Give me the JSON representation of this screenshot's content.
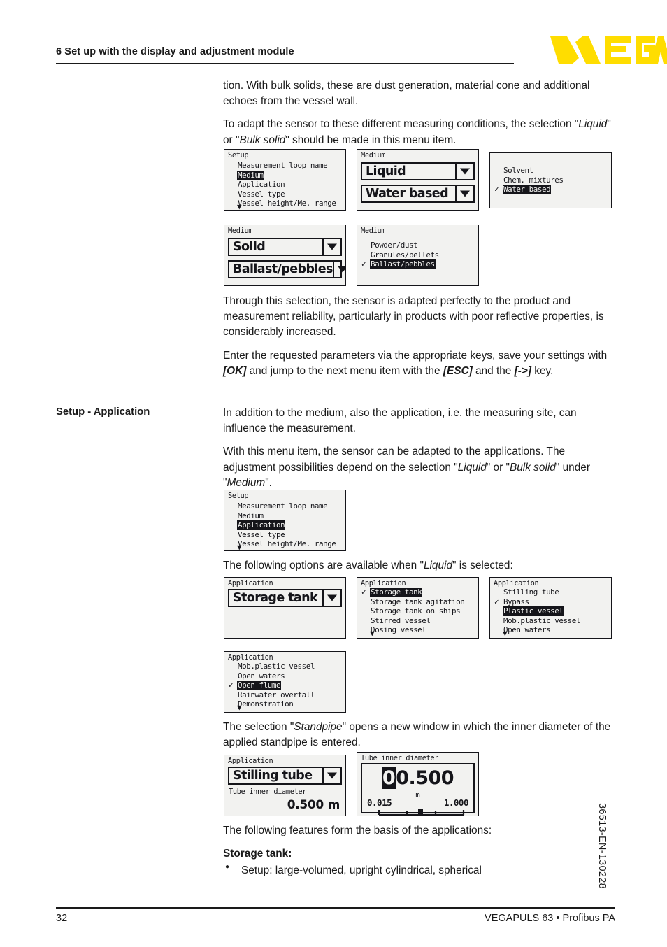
{
  "header": {
    "chapter_title": "6 Set up with the display and adjustment module",
    "logo_text": "VEGA",
    "logo_color": "#FFDD00"
  },
  "footer": {
    "page_number": "32",
    "product_line": "VEGAPULS 63 • Profibus PA",
    "doc_code": "36513-EN-130228"
  },
  "body": {
    "p1_a": "tion. With bulk solids, these are dust generation, material cone and additional echoes from the vessel wall.",
    "p2_pre": "To adapt the sensor to these different measuring conditions, the selection \"",
    "p2_i1": "Liquid",
    "p2_mid": "\" or \"",
    "p2_i2": "Bulk solid",
    "p2_post": "\" should be made in this menu item.",
    "p3": "Through this selection, the sensor is adapted perfectly to the product and measurement reliability, particularly in products with poor reflective properties, is considerably increased.",
    "p4_pre": "Enter the requested parameters via the appropriate keys, save your settings with ",
    "p4_k1": "[OK]",
    "p4_mid": " and jump to the next menu item with the ",
    "p4_k2": "[ESC]",
    "p4_mid2": " and the ",
    "p4_k3": "[->]",
    "p4_post": " key.",
    "marginal_heading": "Setup - Application",
    "p5": "In addition to the medium, also the application, i.e. the measuring site, can influence the measurement.",
    "p6_pre": "With this menu item, the sensor can be adapted to the applications. The adjustment possibilities depend on the selection \"",
    "p6_i1": "Liquid",
    "p6_mid": "\" or \"",
    "p6_i2": "Bulk solid",
    "p6_mid2": "\" under \"",
    "p6_i3": "Medium",
    "p6_post": "\".",
    "p7_pre": "The following options are available when \"",
    "p7_i1": "Liquid",
    "p7_post": "\" is selected:",
    "p8_pre": "The selection \"",
    "p8_i1": "Standpipe",
    "p8_post": "\" opens a new window in which the inner diameter of the applied standpipe is entered.",
    "p9": "The following features form the basis of the applications:",
    "storage_tank_heading": "Storage tank:",
    "storage_tank_bullet_1": "Setup: large-volumed, upright cylindrical, spherical"
  },
  "screens": {
    "setup_medium": {
      "title": "Setup",
      "rows": [
        {
          "label": "Measurement loop name",
          "selected": false,
          "checked": false
        },
        {
          "label": "Medium",
          "selected": true,
          "checked": false
        },
        {
          "label": "Application",
          "selected": false,
          "checked": false
        },
        {
          "label": "Vessel type",
          "selected": false,
          "checked": false
        },
        {
          "label": "Vessel height/Me. range",
          "selected": false,
          "checked": false
        }
      ],
      "more_arrow": "▼"
    },
    "medium_liquid": {
      "title": "Medium",
      "field_1": "Liquid",
      "field_2": "Water based",
      "dropdown_icon": "▼"
    },
    "medium_liquid_list": {
      "title": "",
      "rows": [
        {
          "label": "Solvent",
          "selected": false,
          "checked": false
        },
        {
          "label": "Chem. mixtures",
          "selected": false,
          "checked": false
        },
        {
          "label": "Water based",
          "selected": true,
          "checked": true
        }
      ]
    },
    "medium_solid": {
      "title": "Medium",
      "field_1": "Solid",
      "field_2": "Ballast/pebbles",
      "dropdown_icon": "▼"
    },
    "medium_solid_list": {
      "title": "Medium",
      "rows": [
        {
          "label": "Powder/dust",
          "selected": false,
          "checked": false
        },
        {
          "label": "Granules/pellets",
          "selected": false,
          "checked": false
        },
        {
          "label": "Ballast/pebbles",
          "selected": true,
          "checked": true
        }
      ]
    },
    "setup_application": {
      "title": "Setup",
      "rows": [
        {
          "label": "Measurement loop name",
          "selected": false,
          "checked": false
        },
        {
          "label": "Medium",
          "selected": false,
          "checked": false
        },
        {
          "label": "Application",
          "selected": true,
          "checked": false
        },
        {
          "label": "Vessel type",
          "selected": false,
          "checked": false
        },
        {
          "label": "Vessel height/Me. range",
          "selected": false,
          "checked": false
        }
      ],
      "more_arrow": "▼"
    },
    "application_storage_tank": {
      "title": "Application",
      "field_1": "Storage tank",
      "dropdown_icon": "▼"
    },
    "application_list_1": {
      "title": "Application",
      "rows": [
        {
          "label": "Storage tank",
          "selected": true,
          "checked": true
        },
        {
          "label": "Storage tank agitation",
          "selected": false,
          "checked": false
        },
        {
          "label": "Storage tank on ships",
          "selected": false,
          "checked": false
        },
        {
          "label": "Stirred vessel",
          "selected": false,
          "checked": false
        },
        {
          "label": "Dosing vessel",
          "selected": false,
          "checked": false
        }
      ],
      "more_arrow": "▼"
    },
    "application_list_2": {
      "title": "Application",
      "rows": [
        {
          "label": "Stilling tube",
          "selected": false,
          "checked": false
        },
        {
          "label": "Bypass",
          "selected": false,
          "checked": true
        },
        {
          "label": "Plastic vessel",
          "selected": true,
          "checked": false
        },
        {
          "label": "Mob.plastic vessel",
          "selected": false,
          "checked": false
        },
        {
          "label": "Open waters",
          "selected": false,
          "checked": false
        }
      ],
      "more_arrow": "▼"
    },
    "application_list_3": {
      "title": "Application",
      "rows": [
        {
          "label": "Mob.plastic vessel",
          "selected": false,
          "checked": false
        },
        {
          "label": "Open waters",
          "selected": false,
          "checked": false
        },
        {
          "label": "Open flume",
          "selected": true,
          "checked": true
        },
        {
          "label": "Rainwater overfall",
          "selected": false,
          "checked": false
        },
        {
          "label": "Demonstration",
          "selected": false,
          "checked": false
        }
      ],
      "more_arrow": "▼"
    },
    "application_stilling_tube": {
      "title": "Application",
      "field_1": "Stilling tube",
      "dropdown_icon": "▼",
      "sub_label": "Tube inner diameter",
      "sub_value": "0.500 m"
    },
    "tube_inner_diameter": {
      "title": "Tube inner diameter",
      "digit_cursor": "0",
      "digits_rest": "0.500",
      "unit": "m",
      "range_min": "0.015",
      "range_max": "1.000"
    }
  }
}
